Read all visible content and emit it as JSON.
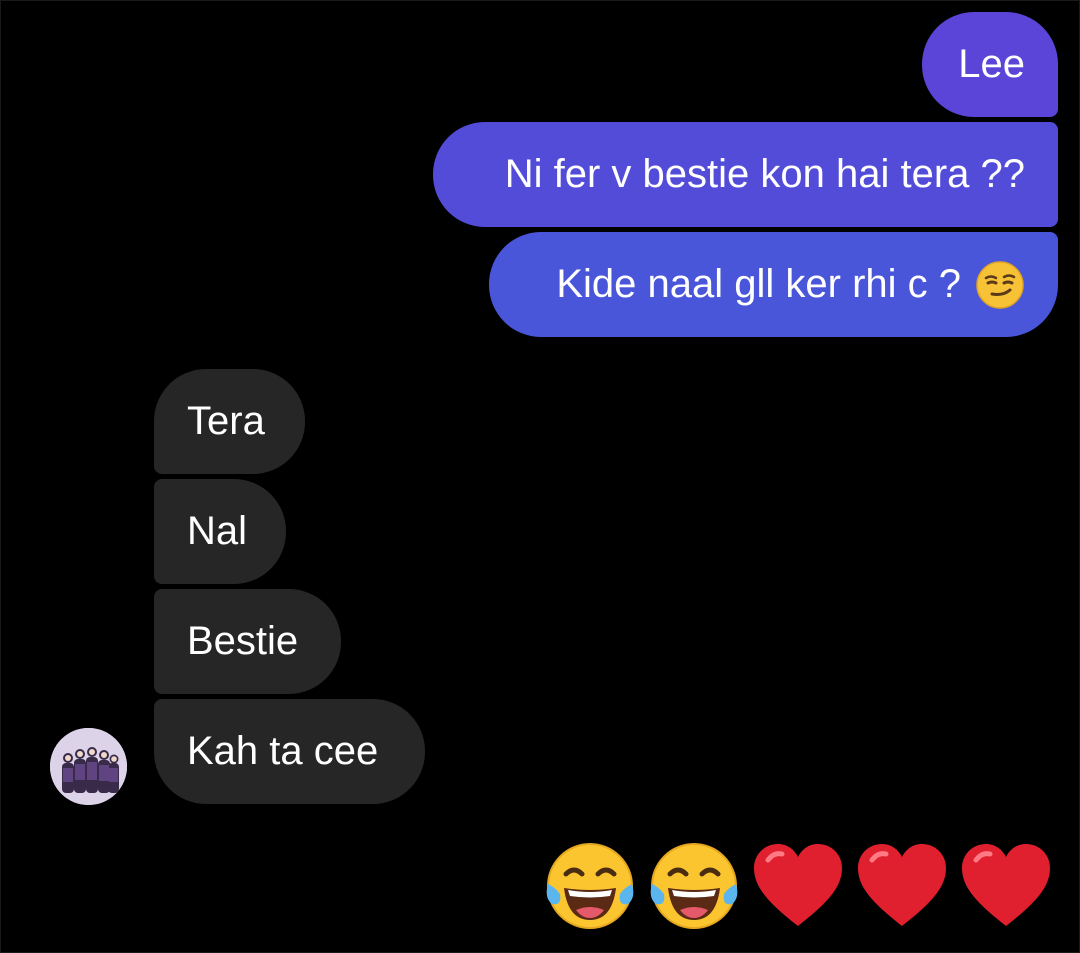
{
  "sent_messages": [
    {
      "text": "Lee"
    },
    {
      "text": "Ni fer v bestie kon hai tera ??"
    },
    {
      "text": "Kide naal gll ker rhi c ?",
      "emoji": "smirking-face"
    }
  ],
  "received_messages": [
    {
      "text": "Tera"
    },
    {
      "text": "Nal"
    },
    {
      "text": "Bestie"
    },
    {
      "text": "Kah ta cee"
    }
  ],
  "reactions": [
    "face-with-tears-of-joy",
    "face-with-tears-of-joy",
    "red-heart",
    "red-heart",
    "red-heart"
  ],
  "colors": {
    "background": "#000000",
    "sent_bubble_top": "#5b45d8",
    "sent_bubble_bottom": "#4956d9",
    "received_bubble": "#262626",
    "text": "#ffffff"
  }
}
